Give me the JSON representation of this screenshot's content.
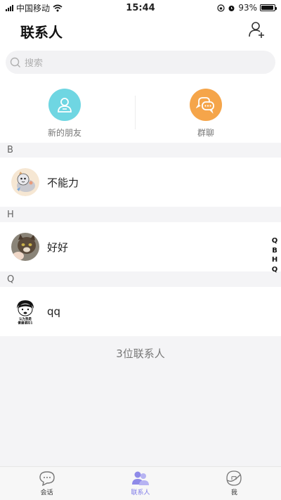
{
  "status_bar": {
    "carrier": "中国移动",
    "time": "15:44",
    "battery": "93%",
    "battery_level": 0.93
  },
  "header": {
    "title": "联系人",
    "add_contact_icon": "add-user-icon"
  },
  "search": {
    "placeholder": "搜索"
  },
  "shortcuts": [
    {
      "label": "新的朋友",
      "icon": "user-icon",
      "color": "#6fd6e2"
    },
    {
      "label": "群聊",
      "icon": "chat-bubbles-icon",
      "color": "#f5a54a"
    }
  ],
  "sections": [
    {
      "letter": "B",
      "contacts": [
        {
          "name": "不能力",
          "avatar": "cartoon-cat-avatar"
        }
      ]
    },
    {
      "letter": "H",
      "contacts": [
        {
          "name": "好好",
          "avatar": "cat-photo-avatar"
        }
      ]
    },
    {
      "letter": "Q",
      "contacts": [
        {
          "name": "qq",
          "avatar": "meme-avatar",
          "avatar_text": [
            "认为我是",
            "傻逼请扣1"
          ]
        }
      ]
    }
  ],
  "index_letters": [
    "Q",
    "B",
    "H",
    "Q"
  ],
  "contact_count": "3位联系人",
  "tabs": [
    {
      "label": "会话",
      "icon": "chat-icon",
      "active": false
    },
    {
      "label": "联系人",
      "icon": "contacts-icon",
      "active": true
    },
    {
      "label": "我",
      "icon": "profile-icon",
      "active": false
    }
  ],
  "colors": {
    "accent": "#7e7ae8",
    "new_friends": "#6fd6e2",
    "group_chat": "#f5a54a",
    "background": "#f4f4f6"
  }
}
